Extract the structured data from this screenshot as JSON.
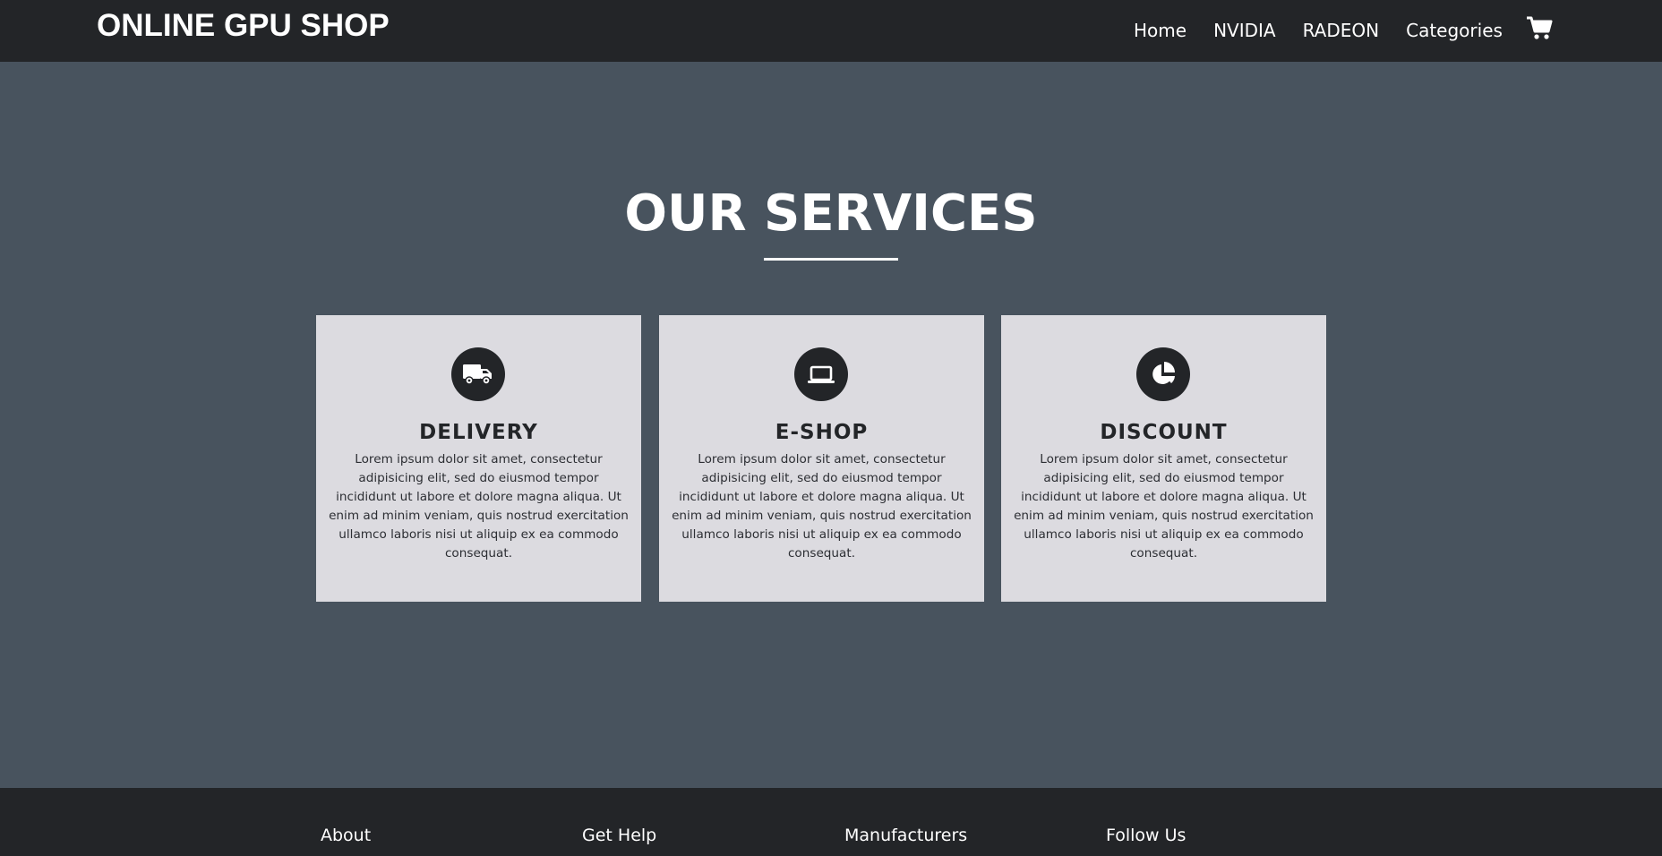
{
  "brand": "ONLINE GPU SHOP",
  "nav": {
    "links": [
      "Home",
      "NVIDIA",
      "RADEON",
      "Categories"
    ],
    "cart_icon": "shopping-cart-icon"
  },
  "services": {
    "title": "OUR SERVICES",
    "cards": [
      {
        "icon": "truck-icon",
        "title": "DELIVERY",
        "text": "Lorem ipsum dolor sit amet, consectetur adipisicing elit, sed do eiusmod tempor incididunt ut labore et dolore magna aliqua. Ut enim ad minim veniam, quis nostrud exercitation ullamco laboris nisi ut aliquip ex ea commodo consequat."
      },
      {
        "icon": "laptop-icon",
        "title": "E-SHOP",
        "text": "Lorem ipsum dolor sit amet, consectetur adipisicing elit, sed do eiusmod tempor incididunt ut labore et dolore magna aliqua. Ut enim ad minim veniam, quis nostrud exercitation ullamco laboris nisi ut aliquip ex ea commodo consequat."
      },
      {
        "icon": "pie-chart-icon",
        "title": "DISCOUNT",
        "text": "Lorem ipsum dolor sit amet, consectetur adipisicing elit, sed do eiusmod tempor incididunt ut labore et dolore magna aliqua. Ut enim ad minim veniam, quis nostrud exercitation ullamco laboris nisi ut aliquip ex ea commodo consequat."
      }
    ]
  },
  "footer": {
    "columns": [
      "About",
      "Get Help",
      "Manufacturers",
      "Follow Us"
    ]
  },
  "colors": {
    "navbar": "#232528",
    "page_background": "#48535e",
    "card_background": "#dcdbe0",
    "footer_accent": "#e91e63"
  }
}
